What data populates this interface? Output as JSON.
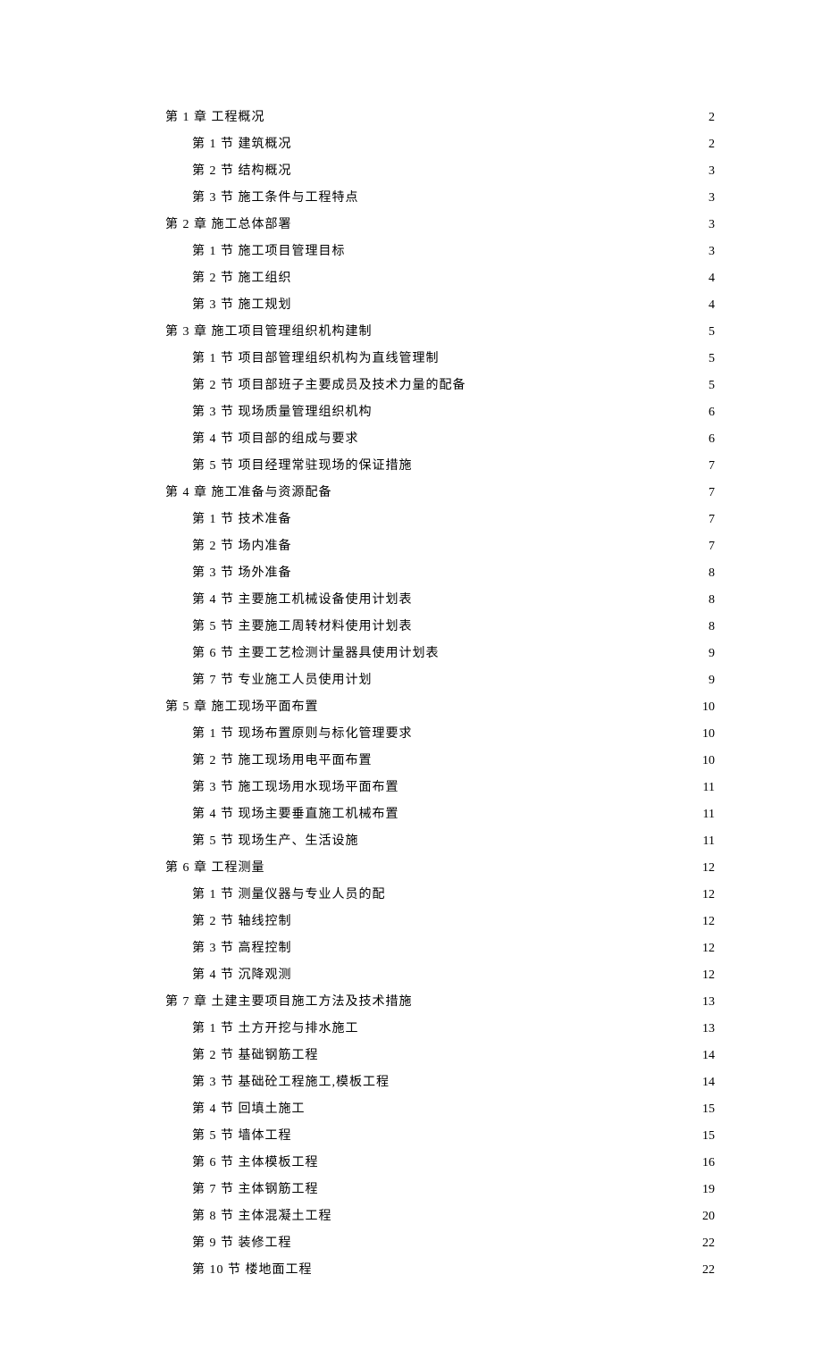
{
  "toc": [
    {
      "level": 1,
      "label": "第 1 章 工程概况",
      "page": "2"
    },
    {
      "level": 2,
      "label": "第 1 节 建筑概况",
      "page": "2"
    },
    {
      "level": 2,
      "label": "第 2 节 结构概况",
      "page": "3"
    },
    {
      "level": 2,
      "label": "第 3 节 施工条件与工程特点",
      "page": "3"
    },
    {
      "level": 1,
      "label": "第 2 章 施工总体部署",
      "page": "3"
    },
    {
      "level": 2,
      "label": "第 1 节 施工项目管理目标",
      "page": "3"
    },
    {
      "level": 2,
      "label": "第 2 节 施工组织",
      "page": "4"
    },
    {
      "level": 2,
      "label": "第 3 节 施工规划",
      "page": "4"
    },
    {
      "level": 1,
      "label": "第 3 章 施工项目管理组织机构建制",
      "page": "5"
    },
    {
      "level": 2,
      "label": "第 1 节 项目部管理组织机构为直线管理制",
      "page": "5"
    },
    {
      "level": 2,
      "label": "第 2 节 项目部班子主要成员及技术力量的配备",
      "page": "5"
    },
    {
      "level": 2,
      "label": "第 3 节 现场质量管理组织机构",
      "page": "6"
    },
    {
      "level": 2,
      "label": "第 4 节 项目部的组成与要求",
      "page": "6"
    },
    {
      "level": 2,
      "label": "第 5 节 项目经理常驻现场的保证措施",
      "page": "7"
    },
    {
      "level": 1,
      "label": "第 4 章 施工准备与资源配备",
      "page": "7"
    },
    {
      "level": 2,
      "label": "第 1 节 技术准备",
      "page": "7"
    },
    {
      "level": 2,
      "label": "第 2 节 场内准备",
      "page": "7"
    },
    {
      "level": 2,
      "label": "第 3 节 场外准备",
      "page": "8"
    },
    {
      "level": 2,
      "label": "第 4 节 主要施工机械设备使用计划表",
      "page": "8"
    },
    {
      "level": 2,
      "label": "第 5 节 主要施工周转材料使用计划表",
      "page": "8"
    },
    {
      "level": 2,
      "label": "第 6 节 主要工艺检测计量器具使用计划表",
      "page": "9"
    },
    {
      "level": 2,
      "label": "第 7 节 专业施工人员使用计划",
      "page": "9"
    },
    {
      "level": 1,
      "label": "第 5 章 施工现场平面布置",
      "page": "10"
    },
    {
      "level": 2,
      "label": "第 1 节 现场布置原则与标化管理要求",
      "page": "10"
    },
    {
      "level": 2,
      "label": "第 2 节 施工现场用电平面布置",
      "page": "10"
    },
    {
      "level": 2,
      "label": "第 3 节 施工现场用水现场平面布置",
      "page": "11"
    },
    {
      "level": 2,
      "label": "第 4 节 现场主要垂直施工机械布置",
      "page": "11"
    },
    {
      "level": 2,
      "label": "第 5 节 现场生产、生活设施",
      "page": "11"
    },
    {
      "level": 1,
      "label": "第 6 章 工程测量",
      "page": "12"
    },
    {
      "level": 2,
      "label": "第 1 节 测量仪器与专业人员的配",
      "page": "12"
    },
    {
      "level": 2,
      "label": "第 2 节 轴线控制",
      "page": "12"
    },
    {
      "level": 2,
      "label": "第 3 节 高程控制",
      "page": "12"
    },
    {
      "level": 2,
      "label": "第 4 节 沉降观测",
      "page": "12"
    },
    {
      "level": 1,
      "label": "第 7 章 土建主要项目施工方法及技术措施",
      "page": "13"
    },
    {
      "level": 2,
      "label": "第 1 节 土方开挖与排水施工",
      "page": "13"
    },
    {
      "level": 2,
      "label": "第 2 节 基础钢筋工程",
      "page": "14"
    },
    {
      "level": 2,
      "label": "第 3 节 基础砼工程施工,模板工程",
      "page": "14"
    },
    {
      "level": 2,
      "label": "第 4 节 回填土施工",
      "page": "15"
    },
    {
      "level": 2,
      "label": "第 5 节 墙体工程",
      "page": "15"
    },
    {
      "level": 2,
      "label": "第 6 节 主体模板工程",
      "page": "16"
    },
    {
      "level": 2,
      "label": "第 7 节 主体钢筋工程",
      "page": "19"
    },
    {
      "level": 2,
      "label": "第 8 节 主体混凝土工程",
      "page": "20"
    },
    {
      "level": 2,
      "label": "第 9 节 装修工程",
      "page": "22"
    },
    {
      "level": 2,
      "label": "第 10 节 楼地面工程",
      "page": "22"
    }
  ]
}
